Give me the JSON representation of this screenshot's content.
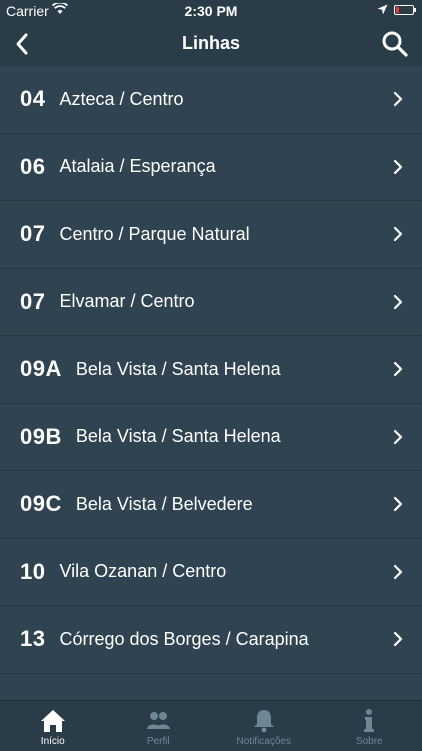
{
  "status": {
    "carrier": "Carrier",
    "time": "2:30 PM"
  },
  "nav": {
    "title": "Linhas"
  },
  "lines": [
    {
      "number": "04",
      "name": "Azteca / Centro"
    },
    {
      "number": "06",
      "name": "Atalaia / Esperança"
    },
    {
      "number": "07",
      "name": "Centro / Parque Natural"
    },
    {
      "number": "07",
      "name": "Elvamar / Centro"
    },
    {
      "number": "09A",
      "name": "Bela Vista / Santa Helena"
    },
    {
      "number": "09B",
      "name": "Bela Vista / Santa Helena"
    },
    {
      "number": "09C",
      "name": "Bela Vista / Belvedere"
    },
    {
      "number": "10",
      "name": "Vila Ozanan / Centro"
    },
    {
      "number": "13",
      "name": "Córrego dos Borges / Carapina"
    }
  ],
  "tabs": [
    {
      "label": "Início",
      "icon": "home-icon",
      "active": true
    },
    {
      "label": "Perfil",
      "icon": "people-icon",
      "active": false
    },
    {
      "label": "Notificações",
      "icon": "bell-icon",
      "active": false
    },
    {
      "label": "Sobre",
      "icon": "info-icon",
      "active": false
    }
  ],
  "colors": {
    "background": "#2f4350",
    "bars": "#2a3c47",
    "inactive_tab": "#6f8794",
    "active_tab": "#ffffff"
  }
}
